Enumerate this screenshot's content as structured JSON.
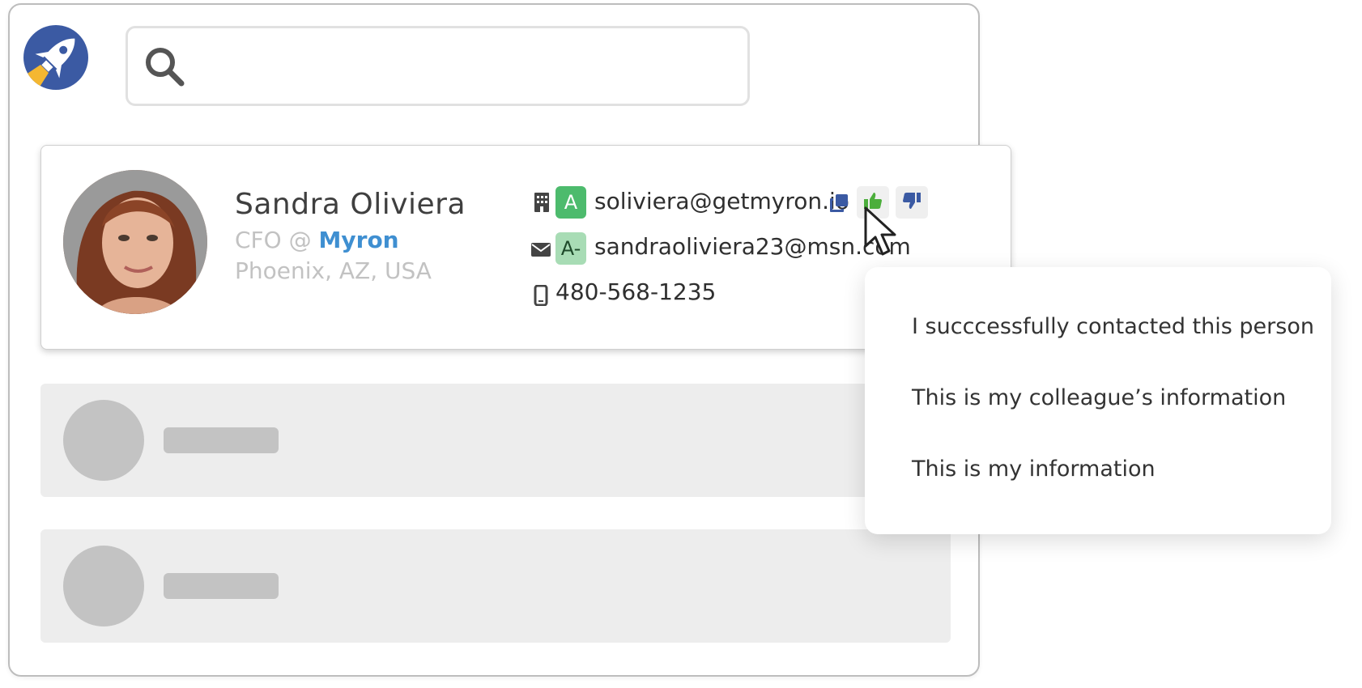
{
  "app": {
    "logo_icon": "rocket-logo-icon",
    "search": {
      "value": "",
      "placeholder": ""
    }
  },
  "contact": {
    "name": "Sandra Oliviera",
    "role": "CFO",
    "at": "@",
    "company": "Myron",
    "location": "Phoenix, AZ, USA",
    "emails": [
      {
        "type_icon": "building-icon",
        "grade": "A",
        "address": "soliviera@getmyron.io"
      },
      {
        "type_icon": "envelope-icon",
        "grade": "A-",
        "address": "sandraoliviera23@msn.com"
      }
    ],
    "phone": {
      "type_icon": "mobile-phone-icon",
      "number": "480-568-1235"
    }
  },
  "actions": {
    "copy_icon": "copy-icon",
    "thumbs_up_icon": "thumbs-up-icon",
    "thumbs_down_icon": "thumbs-down-icon"
  },
  "feedback_menu": {
    "items": [
      "I succcessfully contacted this person",
      "This is my colleague’s information",
      "This is my information"
    ]
  },
  "colors": {
    "brand_blue": "#3b5aa3",
    "brand_yellow": "#f4b731",
    "company_link": "#3f8fd1",
    "grade_a": "#4dbb6d",
    "grade_a_minus": "#a8dcb5",
    "thumbs_up": "#4cae3c",
    "thumbs_down": "#3b5aa3"
  }
}
